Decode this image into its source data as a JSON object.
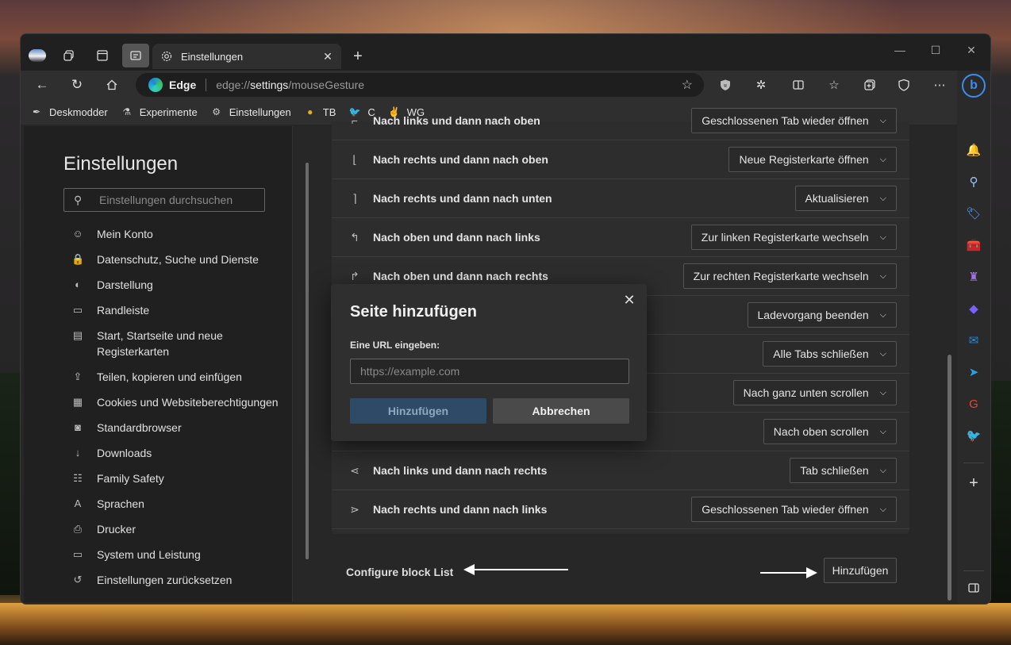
{
  "window": {
    "tab_title": "Einstellungen",
    "tab_close": "✕",
    "new_tab": "+",
    "controls": {
      "minimize": "—",
      "maximize": "☐",
      "close": "✕"
    }
  },
  "toolbar": {
    "brand": "Edge",
    "url_prefix": "edge://",
    "url_bold": "settings",
    "url_suffix": "/mouseGesture"
  },
  "favorites": [
    {
      "icon": "✒",
      "label": "Deskmodder",
      "color": "#cfcfcf"
    },
    {
      "icon": "⚗",
      "label": "Experimente",
      "color": "#cfcfcf"
    },
    {
      "icon": "⚙",
      "label": "Einstellungen",
      "color": "#cfcfcf"
    },
    {
      "icon": "●",
      "label": "TB",
      "color": "#e0b020"
    },
    {
      "icon": "🐦",
      "label": "C",
      "color": "#1d9bf0"
    },
    {
      "icon": "✌",
      "label": "WG",
      "color": "#cfcfcf"
    }
  ],
  "settings_nav": {
    "title": "Einstellungen",
    "search_placeholder": "Einstellungen durchsuchen",
    "items": [
      {
        "icon": "☺",
        "label": "Mein Konto"
      },
      {
        "icon": "🔒",
        "label": "Datenschutz, Suche und Dienste"
      },
      {
        "icon": "◐",
        "label": "Darstellung"
      },
      {
        "icon": "▭",
        "label": "Randleiste"
      },
      {
        "icon": "▤",
        "label": "Start, Startseite und neue Registerkarten"
      },
      {
        "icon": "⇪",
        "label": "Teilen, kopieren und einfügen"
      },
      {
        "icon": "▦",
        "label": "Cookies und Websiteberechtigungen"
      },
      {
        "icon": "◙",
        "label": "Standardbrowser"
      },
      {
        "icon": "↓",
        "label": "Downloads"
      },
      {
        "icon": "☷",
        "label": "Family Safety"
      },
      {
        "icon": "A",
        "label": "Sprachen"
      },
      {
        "icon": "⎙",
        "label": "Drucker"
      },
      {
        "icon": "▭",
        "label": "System und Leistung"
      },
      {
        "icon": "↺",
        "label": "Einstellungen zurücksetzen"
      }
    ]
  },
  "gestures": [
    {
      "icon": "⌐",
      "label": "Nach links und dann nach oben",
      "action": "Geschlossenen Tab wieder öffnen"
    },
    {
      "icon": "⌊",
      "label": "Nach rechts und dann nach oben",
      "action": "Neue Registerkarte öffnen"
    },
    {
      "icon": "⌉",
      "label": "Nach rechts und dann nach unten",
      "action": "Aktualisieren"
    },
    {
      "icon": "↰",
      "label": "Nach oben und dann nach links",
      "action": "Zur linken Registerkarte wechseln"
    },
    {
      "icon": "↱",
      "label": "Nach oben und dann nach rechts",
      "action": "Zur rechten Registerkarte wechseln"
    },
    {
      "icon": "",
      "label": "",
      "action": "Ladevorgang beenden"
    },
    {
      "icon": "",
      "label": "",
      "action": "Alle Tabs schließen"
    },
    {
      "icon": "",
      "label": "",
      "action": "Nach ganz unten scrollen"
    },
    {
      "icon": "",
      "label": "",
      "action": "Nach oben scrollen"
    },
    {
      "icon": "⋖",
      "label": "Nach links und dann nach rechts",
      "action": "Tab schließen"
    },
    {
      "icon": "⋗",
      "label": "Nach rechts und dann nach links",
      "action": "Geschlossenen Tab wieder öffnen"
    }
  ],
  "block_list": {
    "label": "Configure block List",
    "add_button": "Hinzufügen"
  },
  "dialog": {
    "title": "Seite hinzufügen",
    "url_label": "Eine URL eingeben:",
    "url_placeholder": "https://example.com",
    "confirm": "Hinzufügen",
    "cancel": "Abbrechen",
    "close": "✕"
  },
  "sidebar": {
    "bing": "b",
    "add": "+"
  },
  "colors": {
    "accent": "#3b8df2",
    "primary_disabled": "#2e4a66"
  }
}
